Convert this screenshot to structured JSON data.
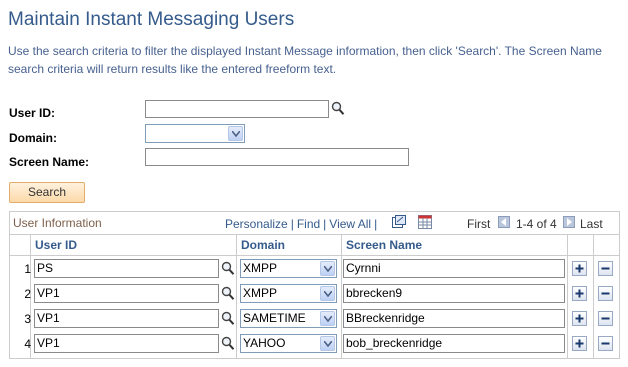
{
  "page": {
    "title": "Maintain Instant Messaging Users",
    "instructions": "Use the search criteria to filter the displayed Instant Message information, then click 'Search'. The Screen Name search criteria will return results like the entered freeform text."
  },
  "search": {
    "user_id_label": "User ID:",
    "user_id_value": "",
    "domain_label": "Domain:",
    "domain_value": "",
    "screen_name_label": "Screen Name:",
    "screen_name_value": "",
    "button_label": "Search"
  },
  "grid": {
    "title": "User Information",
    "personalize": "Personalize",
    "find": "Find",
    "view_all": "View All",
    "first": "First",
    "range": "1-4 of 4",
    "last": "Last",
    "columns": [
      "User ID",
      "Domain",
      "Screen Name"
    ],
    "rows": [
      {
        "num": "1",
        "user_id": "PS",
        "domain": "XMPP",
        "screen_name": "Cyrnni"
      },
      {
        "num": "2",
        "user_id": "VP1",
        "domain": "XMPP",
        "screen_name": "bbrecken9"
      },
      {
        "num": "3",
        "user_id": "VP1",
        "domain": "SAMETIME",
        "screen_name": "BBreckenridge"
      },
      {
        "num": "4",
        "user_id": "VP1",
        "domain": "YAHOO",
        "screen_name": "bob_breckenridge"
      }
    ]
  },
  "colors": {
    "title": "#355b8c",
    "instructions": "#47618f",
    "grid_title": "#7d5f4a",
    "button_bg": "#fcd9a9"
  },
  "icons": {
    "lookup": "magnifier-icon",
    "dropdown": "chevron-down-icon",
    "zoom": "zoom-grid-icon",
    "download": "spreadsheet-icon",
    "add_row": "plus-icon",
    "delete_row": "minus-icon"
  }
}
